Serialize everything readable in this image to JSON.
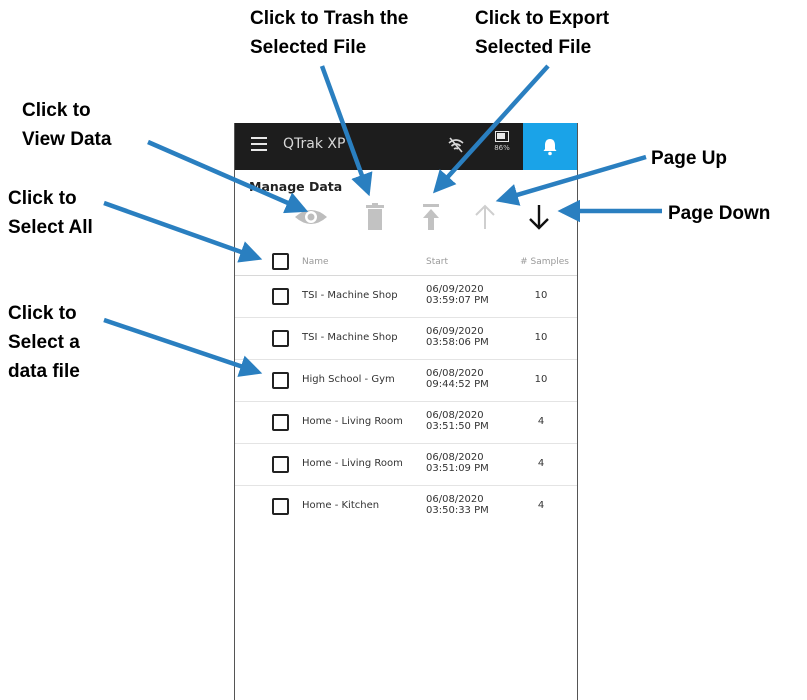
{
  "callouts": {
    "trash": [
      "Click to Trash the",
      "Selected File"
    ],
    "export": [
      "Click to Export",
      "Selected File"
    ],
    "view": [
      "Click to",
      "View Data"
    ],
    "select_all": [
      "Click to",
      "Select All"
    ],
    "page_up": "Page Up",
    "page_down": "Page Down",
    "select_file": [
      "Click to",
      "Select a",
      "data file"
    ]
  },
  "app": {
    "title": "QTrak XP",
    "battery_pct": "86%",
    "section_title": "Manage Data"
  },
  "icons": [
    "menu-icon",
    "wifi-off-icon",
    "battery-icon",
    "bell-icon",
    "eye-icon",
    "trash-icon",
    "export-icon",
    "page-up-arrow-icon",
    "page-down-arrow-icon"
  ],
  "colors": {
    "topbar": "#1d1d1d",
    "accent": "#1aa3e8",
    "callout_arrow": "#2a7fc0"
  },
  "table": {
    "headers": {
      "name": "Name",
      "start": "Start",
      "samples": "# Samples"
    },
    "rows": [
      {
        "name": "TSI - Machine Shop",
        "date": "06/09/2020",
        "time": "03:59:07 PM",
        "samples": "10"
      },
      {
        "name": "TSI - Machine Shop",
        "date": "06/09/2020",
        "time": "03:58:06 PM",
        "samples": "10"
      },
      {
        "name": "High School - Gym",
        "date": "06/08/2020",
        "time": "09:44:52 PM",
        "samples": "10"
      },
      {
        "name": "Home - Living Room",
        "date": "06/08/2020",
        "time": "03:51:50 PM",
        "samples": "4"
      },
      {
        "name": "Home - Living Room",
        "date": "06/08/2020",
        "time": "03:51:09 PM",
        "samples": "4"
      },
      {
        "name": "Home - Kitchen",
        "date": "06/08/2020",
        "time": "03:50:33 PM",
        "samples": "4"
      }
    ]
  }
}
